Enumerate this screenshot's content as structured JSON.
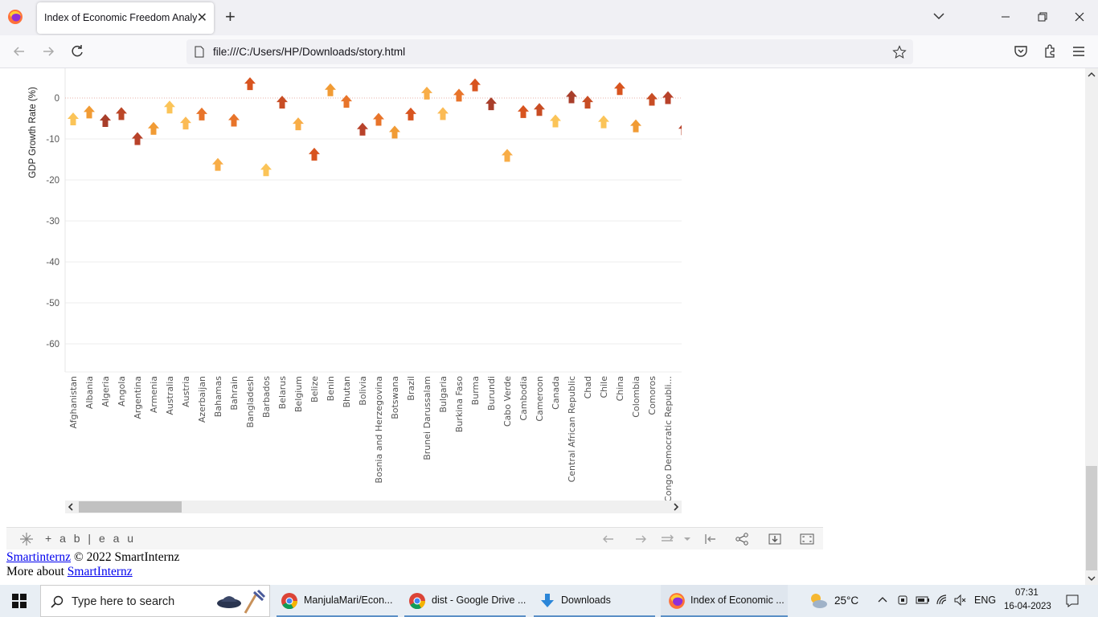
{
  "browser": {
    "tab_title": "Index of Economic Freedom Analysi",
    "url": "file:///C:/Users/HP/Downloads/story.html"
  },
  "chart_data": {
    "type": "scatter",
    "ylabel": "GDP Growth Rate (%)",
    "xlabel": "",
    "ylim": [
      -65,
      6
    ],
    "yticks": [
      0,
      -10,
      -20,
      -30,
      -40,
      -50,
      -60
    ],
    "grid": true,
    "marker": "up-arrow",
    "categories": [
      "Afghanistan",
      "Albania",
      "Algeria",
      "Angola",
      "Argentina",
      "Armenia",
      "Australia",
      "Austria",
      "Azerbaijan",
      "Bahamas",
      "Bahrain",
      "Bangladesh",
      "Barbados",
      "Belarus",
      "Belgium",
      "Belize",
      "Benin",
      "Bhutan",
      "Bolivia",
      "Bosnia and Herzegovina",
      "Botswana",
      "Brazil",
      "Brunei Darussalam",
      "Bulgaria",
      "Burkina Faso",
      "Burma",
      "Burundi",
      "Cabo Verde",
      "Cambodia",
      "Cameroon",
      "Canada",
      "Central African Republic",
      "Chad",
      "Chile",
      "China",
      "Colombia",
      "Comoros",
      "Congo Democratic Republi..."
    ],
    "values": [
      -5.1,
      -3.4,
      -5.5,
      -3.8,
      -9.9,
      -7.4,
      -2.2,
      -6.1,
      -3.9,
      -16.2,
      -5.4,
      3.5,
      -17.5,
      -1.0,
      -6.3,
      -13.7,
      2.0,
      -0.8,
      -7.6,
      -5.2,
      -8.3,
      -3.9,
      1.2,
      -3.8,
      0.7,
      3.2,
      -1.4,
      -14.0,
      -3.3,
      -2.8,
      -5.6,
      0.3,
      -1.0,
      -5.8,
      2.3,
      -6.8,
      -0.3,
      0.1
    ],
    "colors": [
      "#fbc458",
      "#f19b34",
      "#a83e2a",
      "#bb4627",
      "#b8422a",
      "#f19b34",
      "#fbc458",
      "#fbbb55",
      "#e8742a",
      "#f8ad47",
      "#e8742a",
      "#d8541f",
      "#fbc458",
      "#c84d24",
      "#f8ad47",
      "#d8541f",
      "#f19b34",
      "#e8742a",
      "#b8422a",
      "#e8742a",
      "#f19b34",
      "#d8541f",
      "#f8ad47",
      "#fbbb55",
      "#e8742a",
      "#d8541f",
      "#a83e2a",
      "#f8ad47",
      "#d8541f",
      "#c84d24",
      "#fbc458",
      "#a83e2a",
      "#c84d24",
      "#fbc458",
      "#d8541f",
      "#f19b34",
      "#c84d24",
      "#b8422a"
    ],
    "partial_next_value": -7.5
  },
  "tableau": {
    "brand": "+ a b | e a u"
  },
  "footer": {
    "line1_link": "Smartinternz",
    "line1_text": " © 2022 SmartInternz",
    "line2_text": "More about ",
    "line2_link": "SmartInternz"
  },
  "taskbar": {
    "search_placeholder": "Type here to search",
    "items": [
      {
        "label": "ManjulaMari/Econ..."
      },
      {
        "label": "dist - Google Drive ..."
      },
      {
        "label": "Downloads"
      },
      {
        "label": "Index of Economic ..."
      }
    ],
    "weather": "25°C",
    "language": "ENG",
    "time": "07:31",
    "date": "16-04-2023"
  },
  "colors": {
    "grid": "#ececec",
    "zero_line": "#e7b0a8"
  }
}
